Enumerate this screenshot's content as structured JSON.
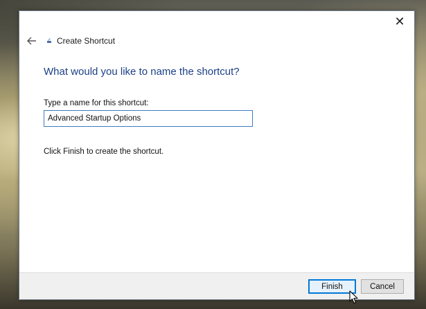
{
  "window": {
    "title": "Create Shortcut",
    "close_glyph": "✕"
  },
  "icons": {
    "back": "back-arrow-icon",
    "app": "shortcut-wizard-icon",
    "close": "close-icon",
    "cursor": "mouse-cursor-icon"
  },
  "content": {
    "heading": "What would you like to name the shortcut?",
    "name_label": "Type a name for this shortcut:",
    "name_value": "Advanced Startup Options",
    "instruction": "Click Finish to create the shortcut."
  },
  "footer": {
    "finish_label": "Finish",
    "cancel_label": "Cancel"
  },
  "colors": {
    "heading": "#1b3f86",
    "input_border": "#3e7bc4",
    "default_button_border": "#0078d7"
  }
}
